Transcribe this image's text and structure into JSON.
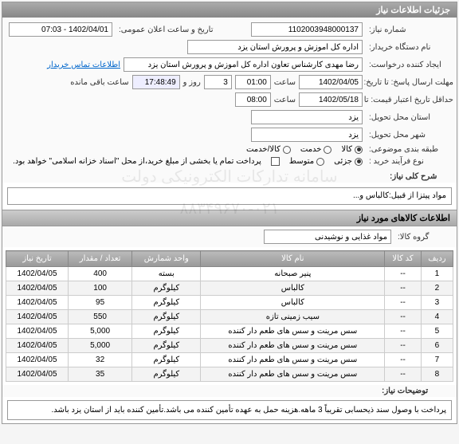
{
  "panel_title": "جزئیات اطلاعات نیاز",
  "fields": {
    "req_no_label": "شماره نیاز:",
    "req_no": "1102003948000137",
    "pub_date_label": "تاریخ و ساعت اعلان عمومی:",
    "pub_date": "1402/04/01 - 07:03",
    "buyer_label": "نام دستگاه خریدار:",
    "buyer": "اداره کل اموزش و پرورش استان یزد",
    "requester_label": "ایجاد کننده درخواست:",
    "requester": "رضا مهدی کارشناس تعاون اداره کل اموزش و پرورش استان یزد",
    "contact_link": "اطلاعات تماس خریدار",
    "reply_deadline_label": "مهلت ارسال پاسخ: تا تاریخ:",
    "reply_deadline_date": "1402/04/05",
    "time_label": "ساعت",
    "reply_deadline_time": "01:00",
    "day_label": "روز و",
    "days_left": "3",
    "time_left": "17:48:49",
    "remaining_label": "ساعت باقی مانده",
    "valid_label": "حداقل تاریخ اعتبار قیمت: تا تاریخ:",
    "valid_date": "1402/05/18",
    "valid_time": "08:00",
    "province_label": "استان محل تحویل:",
    "province": "یزد",
    "city_label": "شهر محل تحویل:",
    "city": "یزد",
    "category_label": "طبقه بندی موضوعی:",
    "cat_goods": "کالا",
    "cat_service": "خدمت",
    "cat_both": "کالا/خدمت",
    "purchase_type_label": "نوع فرآیند خرید :",
    "pt_small": "جزئی",
    "pt_medium": "متوسط",
    "pt_note": "پرداخت تمام یا بخشی از مبلغ خرید،از محل \"اسناد خزانه اسلامی\" خواهد بود.",
    "desc_title": "شرح کلی نیاز:",
    "desc_text": "مواد پیتزا از قبیل:کالباس و...",
    "items_section": "اطلاعات کالاهای مورد نیاز",
    "group_label": "گروه کالا:",
    "group_value": "مواد غذایی و نوشیدنی",
    "note_title": "توضیحات نیاز:",
    "note_text": "پرداخت با وصول سند ذیحسابی تقریباً 3 ماهه.هزینه حمل به عهده تأمین کننده می باشد.تأمین کننده باید از استان یزد باشد."
  },
  "table": {
    "headers": [
      "ردیف",
      "کد کالا",
      "نام کالا",
      "واحد شمارش",
      "تعداد / مقدار",
      "تاریخ نیاز"
    ],
    "rows": [
      [
        "1",
        "--",
        "پنیر صبحانه",
        "بسته",
        "400",
        "1402/04/05"
      ],
      [
        "2",
        "--",
        "کالباس",
        "کیلوگرم",
        "100",
        "1402/04/05"
      ],
      [
        "3",
        "--",
        "کالباس",
        "کیلوگرم",
        "95",
        "1402/04/05"
      ],
      [
        "4",
        "--",
        "سیب زمینی تازه",
        "کیلوگرم",
        "550",
        "1402/04/05"
      ],
      [
        "5",
        "--",
        "سس مرینت و سس های طعم دار کننده",
        "کیلوگرم",
        "5,000",
        "1402/04/05"
      ],
      [
        "6",
        "--",
        "سس مرینت و سس های طعم دار کننده",
        "کیلوگرم",
        "5,000",
        "1402/04/05"
      ],
      [
        "7",
        "--",
        "سس مرینت و سس های طعم دار کننده",
        "کیلوگرم",
        "32",
        "1402/04/05"
      ],
      [
        "8",
        "--",
        "سس مرینت و سس های طعم دار کننده",
        "کیلوگرم",
        "35",
        "1402/04/05"
      ]
    ]
  },
  "watermark": "سامانه تدارکات الکترونیکی دولت\n۰۲۱-۸۸۳۴۹۶۷۰"
}
